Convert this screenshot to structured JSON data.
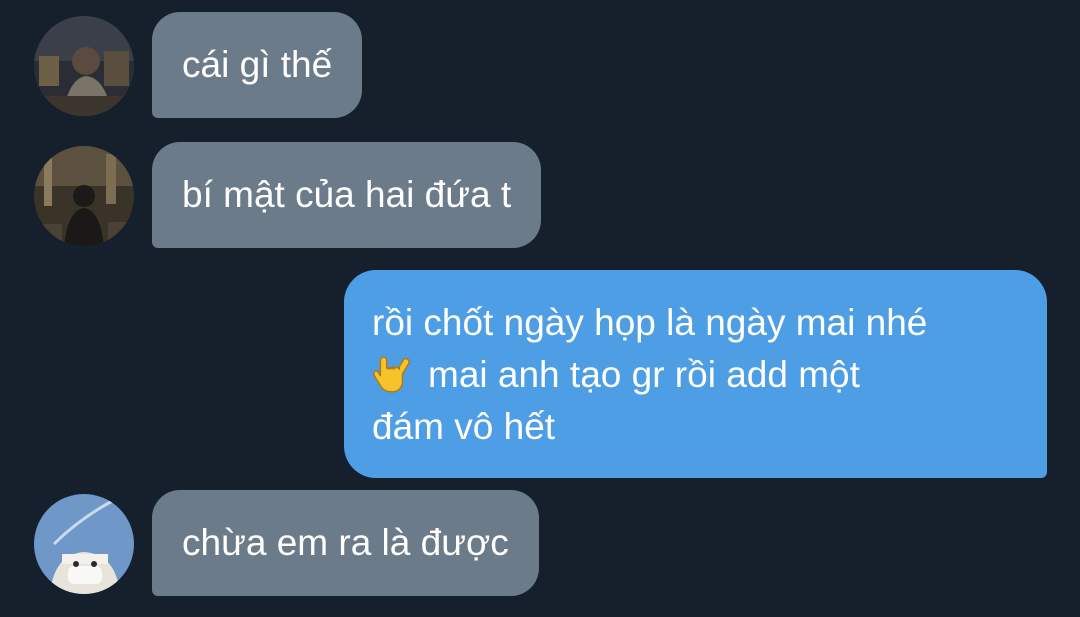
{
  "messages": [
    {
      "direction": "incoming",
      "avatar": "avatar-man-night-city",
      "text": "cái gì thế"
    },
    {
      "direction": "incoming",
      "avatar": "avatar-person-street-back",
      "text": "bí mật của hai đứa t"
    },
    {
      "direction": "outgoing",
      "lines": [
        "rồi chốt ngày họp là ngày mai nhé",
        "mai anh tạo gr rồi add một",
        "đám vô hết"
      ],
      "emoji": "love-you-gesture-icon"
    },
    {
      "direction": "incoming",
      "avatar": "avatar-child-blue-sky",
      "text": "chừa em ra là được"
    }
  ],
  "colors": {
    "background": "#16202c",
    "incoming_bubble": "#6b7b89",
    "outgoing_bubble": "#4e9ee6",
    "text": "#ffffff"
  }
}
